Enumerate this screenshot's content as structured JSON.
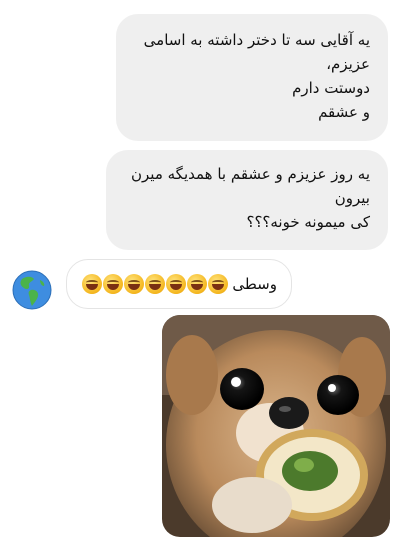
{
  "messages": [
    {
      "id": "msg1",
      "lines": [
        "یه آقایی سه تا دختر داشته به اسامی",
        "عزیزم،",
        "دوستت دارم",
        "و عشقم"
      ]
    },
    {
      "id": "msg2",
      "lines": [
        "یه روز عزیزم و عشقم با همدیگه میرن",
        "بیرون",
        "کی میمونه خونه؟؟؟"
      ]
    },
    {
      "id": "msg3",
      "text": "وسطی",
      "emoji_count": 7,
      "emoji_name": "grinning-squint-emoji"
    }
  ],
  "avatar": {
    "icon": "globe-americas-icon"
  },
  "photo": {
    "subject": "dog-photo"
  },
  "colors": {
    "bubble_gray": "#efefef",
    "reply_border": "#e4e4e4"
  }
}
